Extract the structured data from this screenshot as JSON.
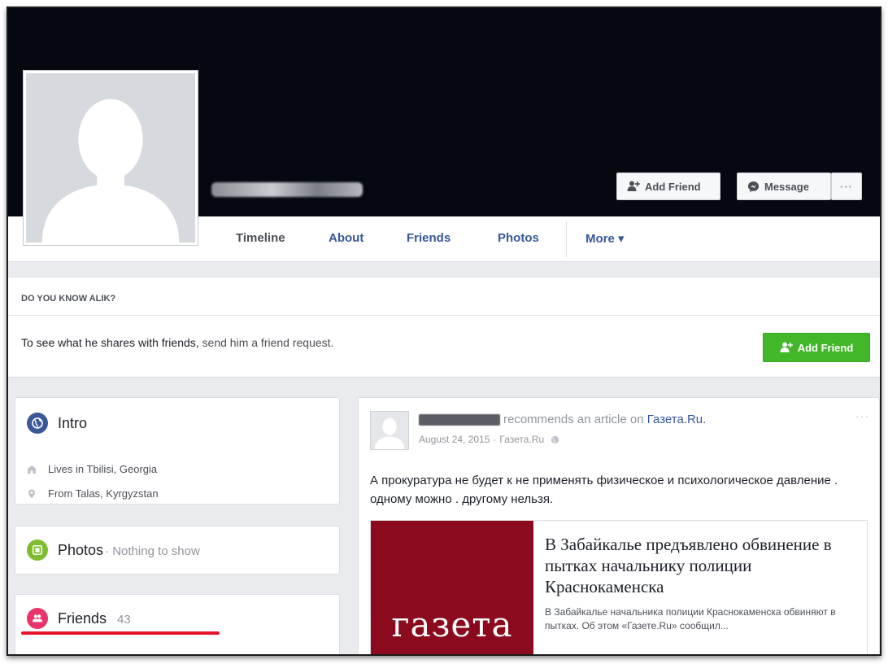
{
  "profile": {
    "name_redacted": true
  },
  "cover_actions": {
    "add_friend_label": "Add Friend",
    "message_label": "Message",
    "more_label": "···"
  },
  "tabs": [
    {
      "label": "Timeline"
    },
    {
      "label": "About"
    },
    {
      "label": "Friends"
    },
    {
      "label": "Photos"
    },
    {
      "label": "More ▾"
    }
  ],
  "know_box": {
    "heading": "DO YOU KNOW ALIK?",
    "text_main": "To see what he shares with friends,",
    "text_muted": " send him a friend request.",
    "add_friend_label": "Add Friend"
  },
  "intro": {
    "title": "Intro",
    "lives_in": "Lives in Tbilisi, Georgia",
    "from": "From Talas, Kyrgyzstan"
  },
  "photos": {
    "title": "Photos",
    "empty": "· Nothing to show"
  },
  "friends": {
    "title": "Friends",
    "count": "43"
  },
  "post": {
    "action_text": " recommends an article on ",
    "source_link": "Газета.Ru.",
    "date": "August 24, 2015",
    "separator": "·",
    "source": "Газета.Ru",
    "body": "А прокуратура не будет к не применять физическое и психологическое давление . одному можно . другому нельзя.",
    "article": {
      "thumb_text": "газета",
      "title": "В Забайкалье предъявлено обвинение в пытках начальнику полиции Краснокаменска",
      "description": "В Забайкалье начальника полиции Краснокаменска обвиняют в пытках. Об этом «Газете.Ru» сообщил..."
    }
  },
  "colors": {
    "cover": "#050810",
    "link": "#365899",
    "green_button": "#42b72a",
    "intro_icon": "#3b5998",
    "photos_icon": "#7fbd2e",
    "friends_icon": "#e8336b",
    "article_thumb": "#8b0a1e",
    "annotation_underline": "#e3142c"
  }
}
